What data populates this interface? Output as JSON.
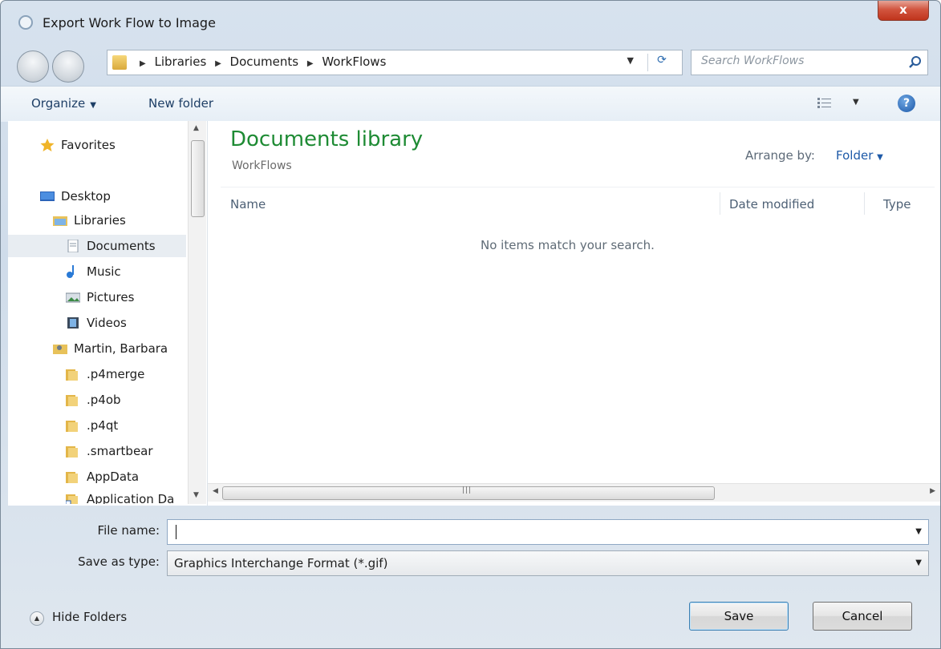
{
  "window": {
    "title": "Export Work Flow to Image",
    "close_label": "x"
  },
  "address": {
    "crumbs": [
      "Libraries",
      "Documents",
      "WorkFlows"
    ]
  },
  "search": {
    "placeholder": "Search WorkFlows"
  },
  "toolbar": {
    "organize_label": "Organize",
    "new_folder_label": "New folder"
  },
  "sidebar": {
    "items": [
      {
        "label": "Favorites",
        "icon": "star-icon"
      },
      {
        "label": "Desktop",
        "icon": "desktop-icon"
      },
      {
        "label": "Libraries",
        "icon": "libraries-icon"
      },
      {
        "label": "Documents",
        "icon": "documents-icon",
        "selected": true
      },
      {
        "label": "Music",
        "icon": "music-icon"
      },
      {
        "label": "Pictures",
        "icon": "pictures-icon"
      },
      {
        "label": "Videos",
        "icon": "videos-icon"
      },
      {
        "label": "Martin, Barbara",
        "icon": "user-folder-icon"
      },
      {
        "label": ".p4merge",
        "icon": "folder-icon"
      },
      {
        "label": ".p4ob",
        "icon": "folder-icon"
      },
      {
        "label": ".p4qt",
        "icon": "folder-icon"
      },
      {
        "label": ".smartbear",
        "icon": "folder-icon"
      },
      {
        "label": "AppData",
        "icon": "folder-icon"
      },
      {
        "label": "Application Da",
        "icon": "shortcut-folder-icon"
      }
    ]
  },
  "content": {
    "library_title": "Documents library",
    "library_subtitle": "WorkFlows",
    "arrange_label": "Arrange by:",
    "arrange_value": "Folder",
    "columns": [
      "Name",
      "Date modified",
      "Type"
    ],
    "empty_message": "No items match your search."
  },
  "form": {
    "file_name_label": "File name:",
    "file_name_value": "",
    "save_type_label": "Save as type:",
    "save_type_value": "Graphics Interchange Format (*.gif)"
  },
  "footer": {
    "hide_folders_label": "Hide Folders",
    "save_label": "Save",
    "cancel_label": "Cancel"
  },
  "colors": {
    "library_title": "#1e8b34",
    "link_blue": "#1e5aa8",
    "close_red": "#c0341c"
  }
}
